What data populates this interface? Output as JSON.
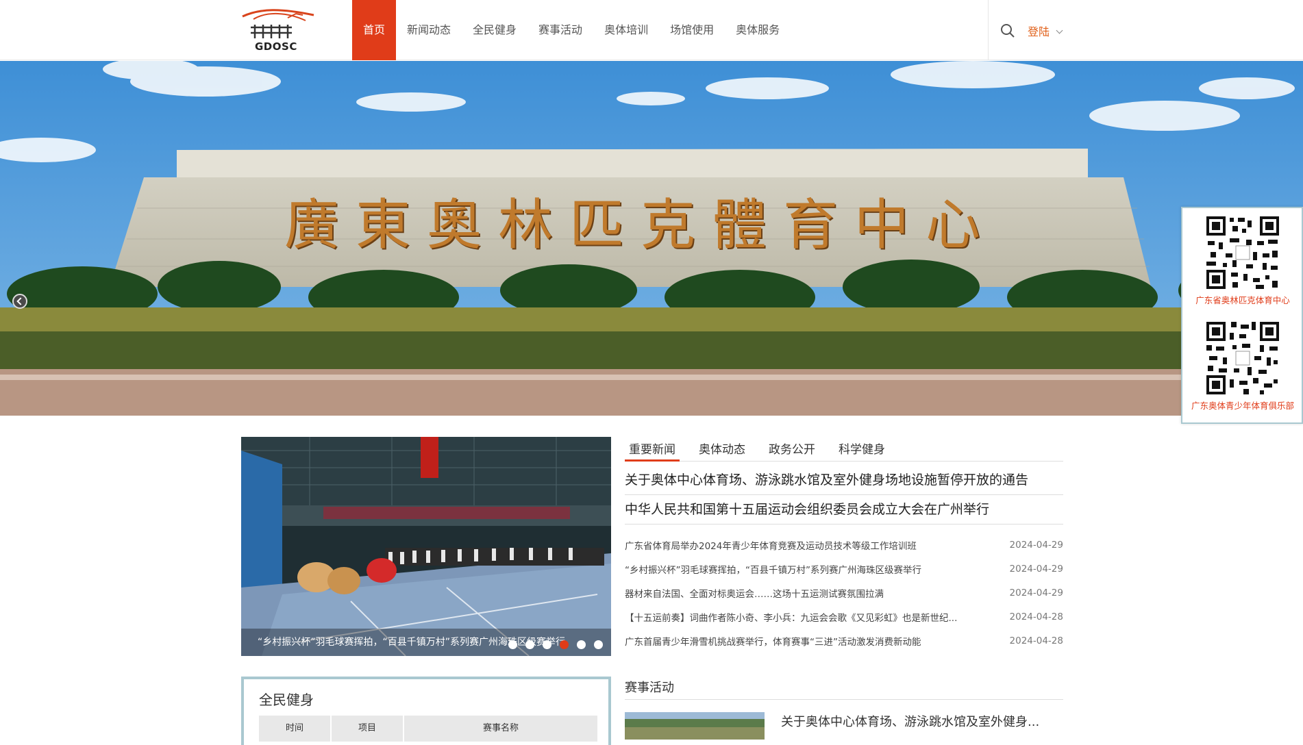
{
  "header": {
    "logo_text": "GDOSC",
    "nav": [
      "首页",
      "新闻动态",
      "全民健身",
      "赛事活动",
      "奥体培训",
      "场馆使用",
      "奥体服务"
    ],
    "login": "登陆"
  },
  "banner": {
    "inscription": "廣東奧林匹克體育中心"
  },
  "qr": [
    {
      "caption": "广东省奥林匹克体育中心"
    },
    {
      "caption": "广东奥体青少年体育俱乐部"
    }
  ],
  "slider": {
    "caption": "“乡村振兴杯”羽毛球赛挥拍，“百县千镇万村”系列赛广州海珠区级赛举行",
    "dot_count": 6,
    "active_dot": 3
  },
  "news": {
    "tabs": [
      "重要新闻",
      "奥体动态",
      "政务公开",
      "科学健身"
    ],
    "headlines": [
      "关于奥体中心体育场、游泳跳水馆及室外健身场地设施暂停开放的通告",
      "中华人民共和国第十五届运动会组织委员会成立大会在广州举行"
    ],
    "items": [
      {
        "title": "广东省体育局举办2024年青少年体育竞赛及运动员技术等级工作培训班",
        "date": "2024-04-29"
      },
      {
        "title": "“乡村振兴杯”羽毛球赛挥拍，“百县千镇万村”系列赛广州海珠区级赛举行",
        "date": "2024-04-29"
      },
      {
        "title": "器材来自法国、全面对标奥运会……这场十五运测试赛氛围拉满",
        "date": "2024-04-29"
      },
      {
        "title": "【十五运前奏】词曲作者陈小奇、李小兵：九运会会歌《又见彩虹》也是新世纪...",
        "date": "2024-04-28"
      },
      {
        "title": "广东首届青少年滑雪机挑战赛举行，体育赛事“三进”活动激发消费新动能",
        "date": "2024-04-28"
      }
    ]
  },
  "fitness": {
    "title": "全民健身",
    "columns": [
      "时间",
      "项目",
      "赛事名称"
    ]
  },
  "events": {
    "title": "赛事活动",
    "first_item": "关于奥体中心体育场、游泳跳水馆及室外健身..."
  },
  "colors": {
    "accent": "#e03c19",
    "login": "#e0601a",
    "panel_border": "#a9c8d0"
  }
}
